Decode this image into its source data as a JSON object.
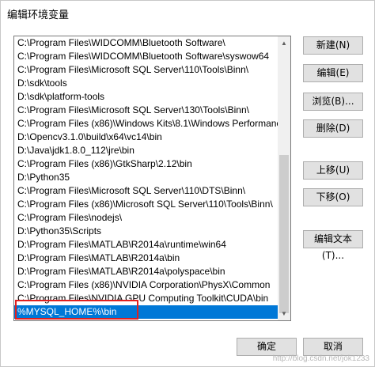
{
  "window": {
    "title": "编辑环境变量"
  },
  "paths": [
    "C:\\Program Files\\WIDCOMM\\Bluetooth Software\\",
    "C:\\Program Files\\WIDCOMM\\Bluetooth Software\\syswow64",
    "C:\\Program Files\\Microsoft SQL Server\\110\\Tools\\Binn\\",
    "D:\\sdk\\tools",
    "D:\\sdk\\platform-tools",
    "C:\\Program Files\\Microsoft SQL Server\\130\\Tools\\Binn\\",
    "C:\\Program Files (x86)\\Windows Kits\\8.1\\Windows Performanc",
    "D:\\Opencv3.1.0\\build\\x64\\vc14\\bin",
    "D:\\Java\\jdk1.8.0_112\\jre\\bin",
    "C:\\Program Files (x86)\\GtkSharp\\2.12\\bin",
    "D:\\Python35",
    "C:\\Program Files\\Microsoft SQL Server\\110\\DTS\\Binn\\",
    "C:\\Program Files (x86)\\Microsoft SQL Server\\110\\Tools\\Binn\\",
    "C:\\Program Files\\nodejs\\",
    "D:\\Python35\\Scripts",
    "D:\\Program Files\\MATLAB\\R2014a\\runtime\\win64",
    "D:\\Program Files\\MATLAB\\R2014a\\bin",
    "D:\\Program Files\\MATLAB\\R2014a\\polyspace\\bin",
    "C:\\Program Files (x86)\\NVIDIA Corporation\\PhysX\\Common",
    "C:\\Program Files\\NVIDIA GPU Computing Toolkit\\CUDA\\bin",
    "%MYSQL_HOME%\\bin"
  ],
  "selected_index": 20,
  "buttons": {
    "new": "新建(N)",
    "edit": "编辑(E)",
    "browse": "浏览(B)...",
    "delete": "删除(D)",
    "move_up": "上移(U)",
    "move_down": "下移(O)",
    "edit_text": "编辑文本(T)...",
    "ok": "确定",
    "cancel": "取消"
  },
  "watermark": "http://blog.csdn.net/jok1233",
  "colors": {
    "selection": "#0078d7",
    "highlight_box": "#e02020"
  }
}
